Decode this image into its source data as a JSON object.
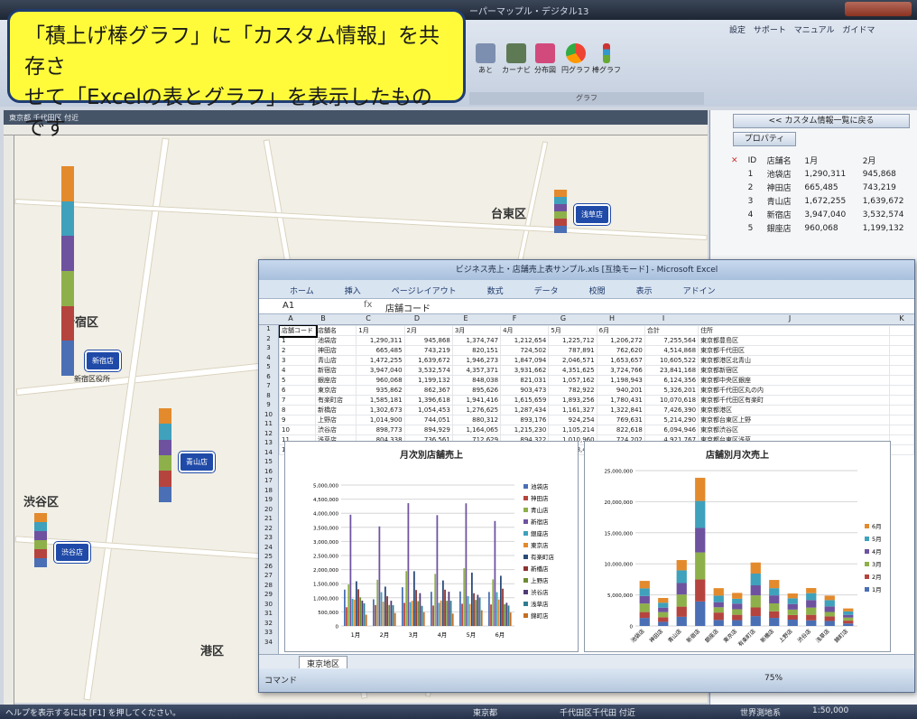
{
  "window": {
    "title": "ーパーマップル・デジタル13"
  },
  "ribbon": {
    "links": [
      "設定",
      "サポート",
      "マニュアル",
      "ガイドマ"
    ],
    "buttons": [
      "あと",
      "カーナビ",
      "分布図",
      "円グラフ",
      "棒グラフ"
    ],
    "group_label": "グラフ"
  },
  "callout": {
    "line1": "「積上げ棒グラフ」に「カスタム情報」を共存さ",
    "line2": "せて「Excelの表とグラフ」を表示したものです"
  },
  "map": {
    "tab_label": "東京都 千代田区 付近",
    "area_labels": [
      "新宿区",
      "渋谷区",
      "台東区",
      "港区"
    ],
    "store_pills": [
      "新宿店",
      "青山店",
      "渋谷店",
      "浅草店"
    ],
    "small_labels": [
      "新宿区役所"
    ]
  },
  "panel": {
    "back_button": "<< カスタム情報一覧に戻る",
    "property_button": "プロパティ",
    "columns": [
      "ID",
      "店舗名",
      "1月",
      "2月"
    ],
    "rows": [
      [
        "1",
        "池袋店",
        "1,290,311",
        "945,868"
      ],
      [
        "2",
        "神田店",
        "665,485",
        "743,219"
      ],
      [
        "3",
        "青山店",
        "1,672,255",
        "1,639,672"
      ],
      [
        "4",
        "新宿店",
        "3,947,040",
        "3,532,574"
      ],
      [
        "5",
        "銀座店",
        "960,068",
        "1,199,132"
      ]
    ]
  },
  "excel": {
    "title": "ビジネス売上・店舗売上表サンプル.xls [互換モード] - Microsoft Excel",
    "tabs": [
      "ホーム",
      "挿入",
      "ページレイアウト",
      "数式",
      "データ",
      "校閲",
      "表示",
      "アドイン"
    ],
    "cell_ref": "A1",
    "formula": "店舗コード",
    "columns": [
      "A",
      "B",
      "C",
      "D",
      "E",
      "F",
      "G",
      "H",
      "I",
      "J",
      "K"
    ],
    "header_row": [
      "店舗コード",
      "店舗名",
      "1月",
      "2月",
      "3月",
      "4月",
      "5月",
      "6月",
      "合計",
      "住所",
      ""
    ],
    "rows": [
      [
        "1",
        "池袋店",
        "1,290,311",
        "945,868",
        "1,374,747",
        "1,212,654",
        "1,225,712",
        "1,206,272",
        "7,255,564",
        "東京都豊島区",
        ""
      ],
      [
        "2",
        "神田店",
        "665,485",
        "743,219",
        "820,151",
        "724,502",
        "787,891",
        "762,620",
        "4,514,868",
        "東京都千代田区",
        ""
      ],
      [
        "3",
        "青山店",
        "1,472,255",
        "1,639,672",
        "1,946,273",
        "1,847,094",
        "2,046,571",
        "1,653,657",
        "10,605,522",
        "東京都港区北青山",
        ""
      ],
      [
        "4",
        "新宿店",
        "3,947,040",
        "3,532,574",
        "4,357,371",
        "3,931,662",
        "4,351,625",
        "3,724,766",
        "23,841,168",
        "東京都新宿区",
        ""
      ],
      [
        "5",
        "銀座店",
        "960,068",
        "1,199,132",
        "848,038",
        "821,031",
        "1,057,162",
        "1,198,943",
        "6,124,356",
        "東京都中央区銀座",
        ""
      ],
      [
        "6",
        "東京店",
        "935,862",
        "862,367",
        "895,626",
        "903,473",
        "782,922",
        "940,201",
        "5,326,201",
        "東京都千代田区丸の内",
        ""
      ],
      [
        "7",
        "有楽町店",
        "1,585,181",
        "1,396,618",
        "1,941,416",
        "1,615,659",
        "1,893,256",
        "1,780,431",
        "10,070,618",
        "東京都千代田区有楽町",
        ""
      ],
      [
        "8",
        "新橋店",
        "1,302,673",
        "1,054,453",
        "1,276,625",
        "1,287,434",
        "1,161,327",
        "1,322,841",
        "7,426,390",
        "東京都港区",
        ""
      ],
      [
        "9",
        "上野店",
        "1,014,900",
        "744,051",
        "880,312",
        "893,176",
        "924,254",
        "769,631",
        "5,214,290",
        "東京都台東区上野",
        ""
      ],
      [
        "10",
        "渋谷店",
        "898,773",
        "894,929",
        "1,164,065",
        "1,215,230",
        "1,105,214",
        "822,618",
        "6,094,946",
        "東京都渋谷区",
        ""
      ],
      [
        "11",
        "浅草店",
        "804,338",
        "736,561",
        "712,629",
        "894,322",
        "1,010,960",
        "724,202",
        "4,921,767",
        "東京都台東区浅草",
        ""
      ],
      [
        "12",
        "錦町店",
        "398,940",
        "459,418",
        "487,438",
        "437,947",
        "558,477",
        "477,544",
        "2,749,904",
        "東京都千代田区錦町",
        ""
      ]
    ],
    "sheet_tab": "東京地区",
    "status_left": "コマンド",
    "zoom": "75%"
  },
  "statusbar": {
    "left": "ヘルプを表示するには [F1] を押してください。",
    "prefecture": "東京都",
    "area": "千代田区千代田 付近",
    "geodesy": "世界測地系",
    "scale": "1:50,000"
  },
  "chart_data": [
    {
      "type": "bar",
      "title": "月次別店舗売上",
      "categories": [
        "1月",
        "2月",
        "3月",
        "4月",
        "5月",
        "6月"
      ],
      "ylim": [
        0,
        5000000
      ],
      "yticks": [
        "5,000,000",
        "4,500,000",
        "4,000,000",
        "3,500,000",
        "3,000,000",
        "2,500,000",
        "2,000,000",
        "1,500,000",
        "1,000,000",
        "500,000",
        "0"
      ],
      "legend_position": "right",
      "series": [
        {
          "name": "池袋店",
          "color": "#4a6fb5",
          "values": [
            1290311,
            945868,
            1374747,
            1212654,
            1225712,
            1206272
          ]
        },
        {
          "name": "神田店",
          "color": "#b5443f",
          "values": [
            665485,
            743219,
            820151,
            724502,
            787891,
            762620
          ]
        },
        {
          "name": "青山店",
          "color": "#8eb04a",
          "values": [
            1472255,
            1639672,
            1946273,
            1847094,
            2046571,
            1653657
          ]
        },
        {
          "name": "新宿店",
          "color": "#6e52a0",
          "values": [
            3947040,
            3532574,
            4357371,
            3931662,
            4351625,
            3724766
          ]
        },
        {
          "name": "銀座店",
          "color": "#3fa1bb",
          "values": [
            960068,
            1199132,
            848038,
            821031,
            1057162,
            1198943
          ]
        },
        {
          "name": "東京店",
          "color": "#e38a2d",
          "values": [
            935862,
            862367,
            895626,
            903473,
            782922,
            940201
          ]
        },
        {
          "name": "有楽町店",
          "color": "#2a4a78",
          "values": [
            1585181,
            1396618,
            1941416,
            1615659,
            1893256,
            1780431
          ]
        },
        {
          "name": "新橋店",
          "color": "#8c3330",
          "values": [
            1302673,
            1054453,
            1276625,
            1287434,
            1161327,
            1322841
          ]
        },
        {
          "name": "上野店",
          "color": "#6d8a33",
          "values": [
            1014900,
            744051,
            880312,
            893176,
            924254,
            769631
          ]
        },
        {
          "name": "渋谷店",
          "color": "#4e3a78",
          "values": [
            898773,
            894929,
            1164065,
            1215230,
            1105214,
            822618
          ]
        },
        {
          "name": "浅草店",
          "color": "#2f7d92",
          "values": [
            804338,
            736561,
            712629,
            894322,
            1010960,
            724202
          ]
        },
        {
          "name": "錦町店",
          "color": "#c36f24",
          "values": [
            398940,
            459418,
            487438,
            437947,
            558477,
            477544
          ]
        }
      ]
    },
    {
      "type": "bar",
      "stacked": true,
      "title": "店舗別月次売上",
      "categories": [
        "池袋店",
        "神田店",
        "青山店",
        "新宿店",
        "銀座店",
        "東京店",
        "有楽町店",
        "新橋店",
        "上野店",
        "渋谷店",
        "浅草店",
        "錦町店"
      ],
      "ylim": [
        0,
        25000000
      ],
      "yticks": [
        "25,000,000",
        "20,000,000",
        "15,000,000",
        "10,000,000",
        "5,000,000",
        "0"
      ],
      "legend_position": "right",
      "series": [
        {
          "name": "1月",
          "color": "#4a6fb5",
          "values": [
            1290311,
            665485,
            1472255,
            3947040,
            960068,
            935862,
            1585181,
            1302673,
            1014900,
            898773,
            804338,
            398940
          ]
        },
        {
          "name": "2月",
          "color": "#b5443f",
          "values": [
            945868,
            743219,
            1639672,
            3532574,
            1199132,
            862367,
            1396618,
            1054453,
            744051,
            894929,
            736561,
            459418
          ]
        },
        {
          "name": "3月",
          "color": "#8eb04a",
          "values": [
            1374747,
            820151,
            1946273,
            4357371,
            848038,
            895626,
            1941416,
            1276625,
            880312,
            1164065,
            712629,
            487438
          ]
        },
        {
          "name": "4月",
          "color": "#6e52a0",
          "values": [
            1212654,
            724502,
            1847094,
            3931662,
            821031,
            903473,
            1615659,
            1287434,
            893176,
            1215230,
            894322,
            437947
          ]
        },
        {
          "name": "5月",
          "color": "#3fa1bb",
          "values": [
            1225712,
            787891,
            2046571,
            4351625,
            1057162,
            782922,
            1893256,
            1161327,
            924254,
            1105214,
            1010960,
            558477
          ]
        },
        {
          "name": "6月",
          "color": "#e38a2d",
          "values": [
            1206272,
            762620,
            1653657,
            3724766,
            1198943,
            940201,
            1780431,
            1322841,
            769631,
            822618,
            724202,
            477544
          ]
        }
      ]
    }
  ]
}
